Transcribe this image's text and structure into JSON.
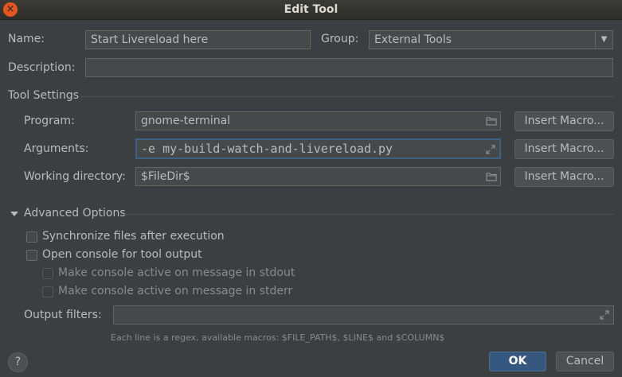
{
  "window": {
    "title": "Edit Tool",
    "close_glyph": "×"
  },
  "form": {
    "name_label": "Name:",
    "name_value": "Start Livereload here",
    "group_label": "Group:",
    "group_value": "External Tools",
    "description_label": "Description:",
    "description_value": ""
  },
  "tool_settings": {
    "section_label": "Tool Settings",
    "program_label": "Program:",
    "program_value": "gnome-terminal",
    "arguments_label": "Arguments:",
    "arguments_value": "-e my-build-watch-and-livereload.py",
    "working_dir_label": "Working directory:",
    "working_dir_value": "$FileDir$",
    "insert_macro_label": "Insert Macro..."
  },
  "advanced": {
    "section_label": "Advanced Options",
    "expanded": true,
    "sync_files": {
      "label": "Synchronize files after execution",
      "checked": false
    },
    "open_console": {
      "label": "Open console for tool output",
      "checked": false
    },
    "active_stdout": {
      "label": "Make console active on message in stdout",
      "checked": false,
      "enabled": false
    },
    "active_stderr": {
      "label": "Make console active on message in stderr",
      "checked": false,
      "enabled": false
    },
    "output_filters_label": "Output filters:",
    "output_filters_value": "",
    "hint": "Each line is a regex, available macros: $FILE_PATH$, $LINE$ and $COLUMN$"
  },
  "footer": {
    "help_glyph": "?",
    "ok_label": "OK",
    "cancel_label": "Cancel"
  },
  "icons": {
    "folder": "folder-icon",
    "expand": "expand-icon",
    "chevron": "chevron-down-icon",
    "help": "help-icon"
  },
  "colors": {
    "background": "#3c3f41",
    "field": "#45494a",
    "focus_border": "#3d6185",
    "ok_button": "#365880",
    "close_button": "#e9541f"
  }
}
